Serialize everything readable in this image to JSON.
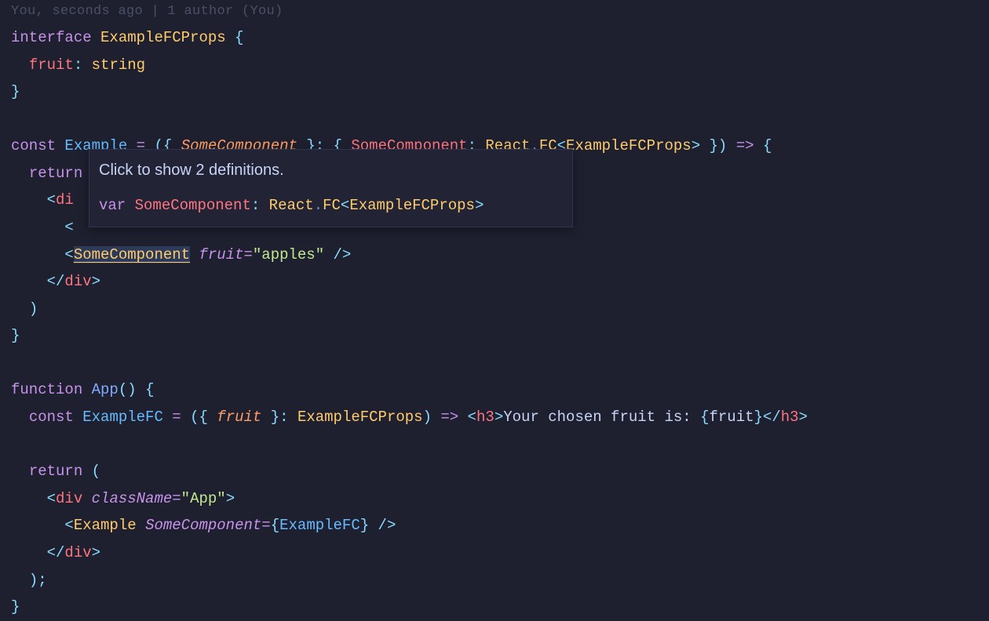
{
  "blame": "You, seconds ago | 1 author (You)",
  "code": {
    "interfaceKw": "interface",
    "interfaceName": "ExampleFCProps",
    "openBrace": "{",
    "closeBrace": "}",
    "fruitProp": "fruit",
    "colon": ":",
    "stringType": "string",
    "constKw": "const",
    "exampleName": "Example",
    "eq": "=",
    "lparen": "(",
    "rparen": ")",
    "destructOpen": "{",
    "someComponentParam": "SomeComponent",
    "destructClose": "}",
    "typeColon": ":",
    "someComponentKey": "SomeComponent",
    "reactNs": "React",
    "dot": ".",
    "fcType": "FC",
    "lt": "<",
    "gt": ">",
    "exampleFCPropsRef": "ExampleFCProps",
    "arrow": "=>",
    "returnKw": "return",
    "divTag": "div",
    "someComponentJsx": "SomeComponent",
    "fruitAttr": "fruit",
    "applesStr": "\"apples\"",
    "slash": "/",
    "functionKw": "function",
    "appName": "App",
    "exampleFCName": "ExampleFC",
    "fruitParam": "fruit",
    "h3Tag": "h3",
    "yourChosen": "Your chosen fruit is: ",
    "fruitExpr": "fruit",
    "classNameAttr": "className",
    "appStr": "\"App\"",
    "exampleJsx": "Example",
    "someComponentAttr": "SomeComponent",
    "exampleFCRef": "ExampleFC",
    "semi": ";"
  },
  "tooltip": {
    "title": "Click to show 2 definitions.",
    "varKw": "var",
    "name": "SomeComponent",
    "colon": ":",
    "reactNs": "React",
    "dot": ".",
    "fcType": "FC",
    "lt": "<",
    "propsType": "ExampleFCProps",
    "gt": ">"
  }
}
